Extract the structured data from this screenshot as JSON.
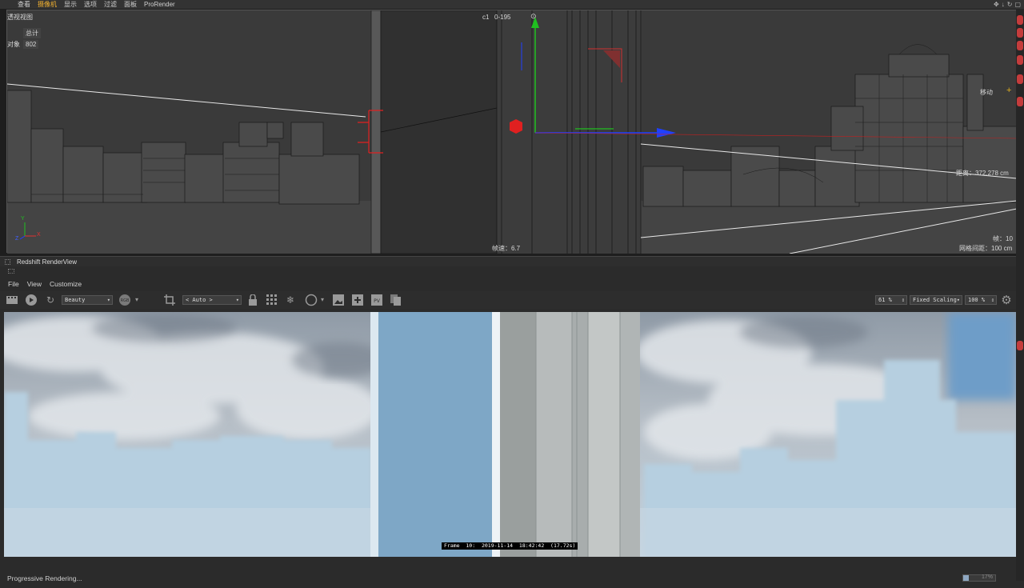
{
  "viewport": {
    "menu": [
      "查看",
      "摄像机",
      "显示",
      "选项",
      "过滤",
      "面板",
      "ProRender"
    ],
    "active_menu_index": 1,
    "view_name": "透视视图",
    "stats": {
      "total_label": "总计",
      "objects_label": "对象",
      "objects_value": "802"
    },
    "camera_label": "c1",
    "frame_range": "0-195",
    "move_label": "移动",
    "distance_label": "距离：372.278 cm",
    "frame_label": "帧：10",
    "fps_label": "帧速：6.7",
    "grid_label": "网格间距：100 cm",
    "axis_y": "Y",
    "axis_x": "X",
    "axis_z": "Z"
  },
  "renderview": {
    "title": "Redshift RenderView",
    "menu": [
      "File",
      "View",
      "Customize"
    ],
    "aov_select": "Beauty",
    "crop_select": "< Auto >",
    "zoom_value": "61 %",
    "scaling_select": "Fixed Scaling",
    "scale_value": "100 %",
    "frame_stamp": "Frame  10:  2019-11-14  18:42:42  (17.72s)",
    "status_text": "Progressive Rendering...",
    "progress_percent": 17,
    "progress_label": "17%"
  },
  "colors": {
    "active_menu": "#f0b030",
    "axis_x": "#e03030",
    "axis_y": "#20c020",
    "axis_z": "#2040ff"
  },
  "icons": [
    "film-icon",
    "play-icon",
    "refresh-icon",
    "rgb-icon",
    "crop-icon",
    "lock-icon",
    "grid-icon",
    "snowflake-icon",
    "circle-icon",
    "image-icon",
    "add-snapshot-icon",
    "pv-icon",
    "copy-icon",
    "gear-icon"
  ]
}
